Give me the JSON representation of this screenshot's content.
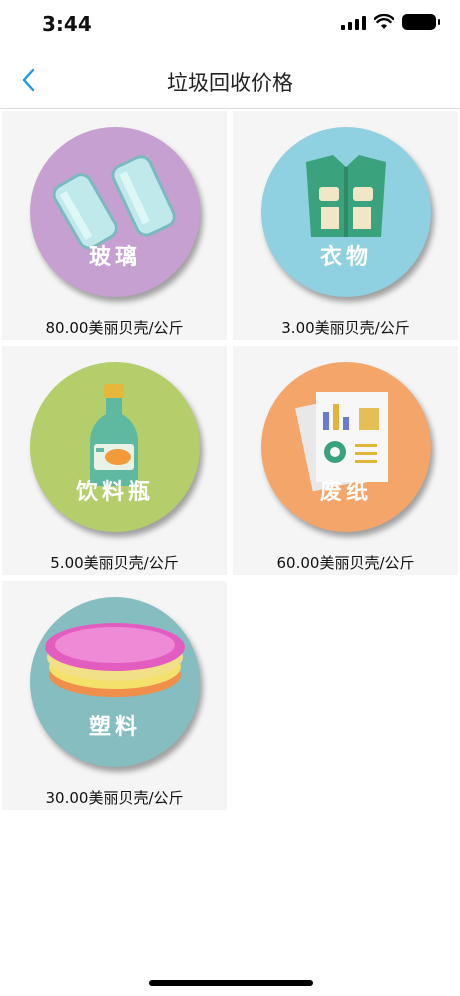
{
  "status": {
    "time": "3:44"
  },
  "nav": {
    "title": "垃圾回收价格"
  },
  "items": [
    {
      "label": "玻璃",
      "price": "80.00美丽贝壳/公斤",
      "bg": "#c6a0d0"
    },
    {
      "label": "衣物",
      "price": "3.00美丽贝壳/公斤",
      "bg": "#8fd0e1"
    },
    {
      "label": "饮料瓶",
      "price": "5.00美丽贝壳/公斤",
      "bg": "#b3ce6a"
    },
    {
      "label": "废纸",
      "price": "60.00美丽贝壳/公斤",
      "bg": "#f3a56a"
    },
    {
      "label": "塑料",
      "price": "30.00美丽贝壳/公斤",
      "bg": "#86bdc1"
    }
  ],
  "colors": {
    "accent": "#1a9be6",
    "card_bg": "#f5f5f5"
  }
}
